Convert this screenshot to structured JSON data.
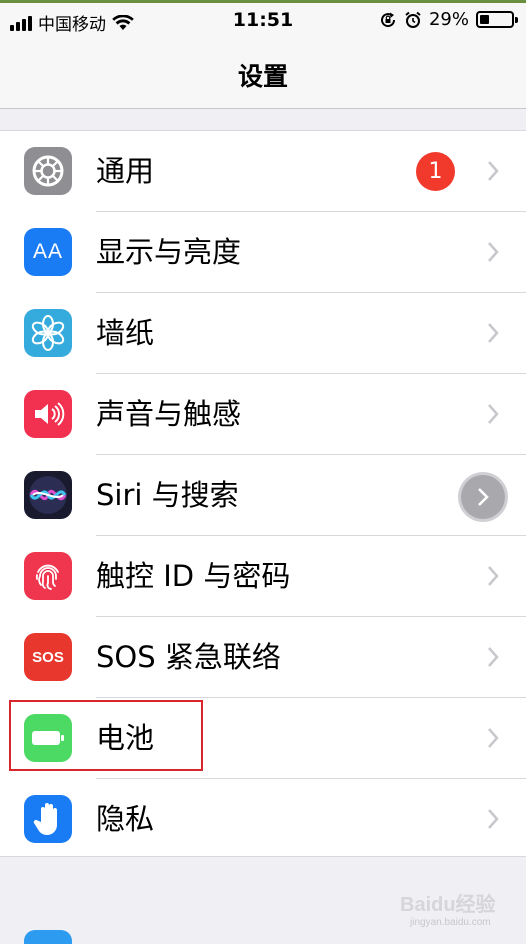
{
  "status_bar": {
    "carrier": "中国移动",
    "time": "11:51",
    "battery_percent": "29%",
    "battery_level": 0.29
  },
  "nav": {
    "title": "设置"
  },
  "settings": {
    "items": [
      {
        "label": "通用",
        "badge": "1"
      },
      {
        "label": "显示与亮度",
        "icon_text": "AA"
      },
      {
        "label": "墙纸"
      },
      {
        "label": "声音与触感"
      },
      {
        "label": "Siri 与搜索"
      },
      {
        "label": "触控 ID 与密码"
      },
      {
        "label": "SOS 紧急联络",
        "icon_text": "SOS"
      },
      {
        "label": "电池"
      },
      {
        "label": "隐私"
      }
    ]
  },
  "icons": {
    "general": "gear-icon",
    "display": "text-size-icon",
    "wallpaper": "flower-icon",
    "sounds": "speaker-icon",
    "siri": "siri-icon",
    "touch_id": "fingerprint-icon",
    "sos": "sos-icon",
    "battery": "battery-icon",
    "privacy": "hand-icon"
  },
  "colors": {
    "general": "#8e8e93",
    "display": "#1a7cf5",
    "wallpaper": "#35aadc",
    "sounds": "#f2304f",
    "siri": "#1a1a2e",
    "touch_id": "#f0354e",
    "sos": "#e8372d",
    "battery": "#4cd964",
    "privacy": "#1a7cf5",
    "badge": "#f23a2c",
    "highlight": "#d9262c"
  },
  "watermark": {
    "text": "Baidu经验",
    "sub": "jingyan.baidu.com"
  }
}
